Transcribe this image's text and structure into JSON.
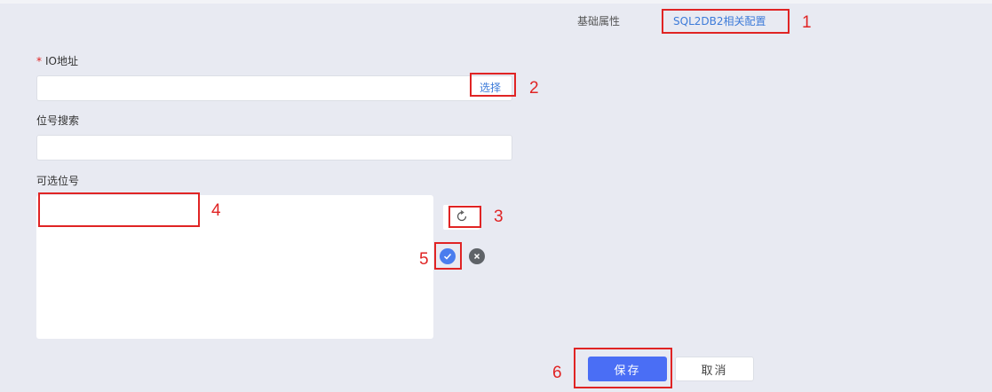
{
  "tabs": {
    "basic": "基础属性",
    "sql2db2": "SQL2DB2相关配置"
  },
  "form": {
    "io_address": {
      "required_mark": "*",
      "label": "IO地址",
      "value": "",
      "select_label": "选择"
    },
    "bit_search": {
      "label": "位号搜索",
      "value": ""
    },
    "available_bits": {
      "label": "可选位号",
      "items": []
    }
  },
  "icons": {
    "refresh": "refresh-icon",
    "confirm": "check-circle-icon",
    "clear": "close-circle-icon"
  },
  "actions": {
    "save": "保存",
    "cancel": "取消"
  },
  "annotations": [
    "1",
    "2",
    "3",
    "4",
    "5",
    "6"
  ],
  "colors": {
    "annotation": "#e02424",
    "primary": "#4a6ef5",
    "link": "#3d7bd9",
    "background": "#e8eaf2"
  }
}
